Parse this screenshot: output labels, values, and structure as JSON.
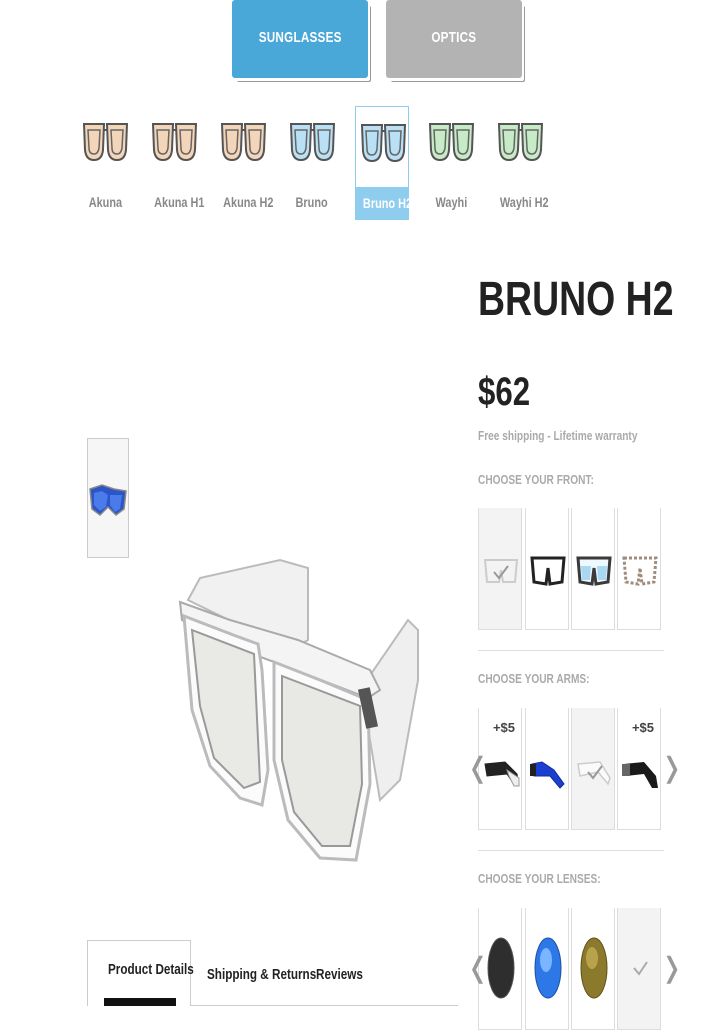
{
  "categories": [
    {
      "label": "SUNGLASSES",
      "active": true
    },
    {
      "label": "OPTICS",
      "active": false
    }
  ],
  "models": [
    {
      "label": "Akuna",
      "tint": "#f0cba8"
    },
    {
      "label": "Akuna H1",
      "tint": "#f0cba8"
    },
    {
      "label": "Akuna H2",
      "tint": "#f0cba8"
    },
    {
      "label": "Bruno",
      "tint": "#a9d8f2"
    },
    {
      "label": "Bruno H2",
      "tint": "#a9d8f2",
      "active": true
    },
    {
      "label": "Wayhi",
      "tint": "#b9e6b8"
    },
    {
      "label": "Wayhi H2",
      "tint": "#b9e6b8"
    }
  ],
  "product": {
    "title": "BRUNO H2",
    "price": "$62",
    "shipping": "Free shipping - Lifetime warranty"
  },
  "sections": {
    "front_label": "CHOOSE YOUR FRONT:",
    "arms_label": "CHOOSE YOUR ARMS:",
    "lenses_label": "CHOOSE YOUR LENSES:"
  },
  "arms": {
    "extra_1": "+$5",
    "extra_4": "+$5"
  },
  "arrows": {
    "left": "❬",
    "right": "❭"
  },
  "tabs": {
    "details": "Product Details",
    "shipping": "Shipping & Returns",
    "reviews": "Reviews"
  },
  "colors": {
    "accent": "#4aa8d8",
    "active_model": "#8fcdef",
    "inactive_category": "#b3b3b3"
  }
}
